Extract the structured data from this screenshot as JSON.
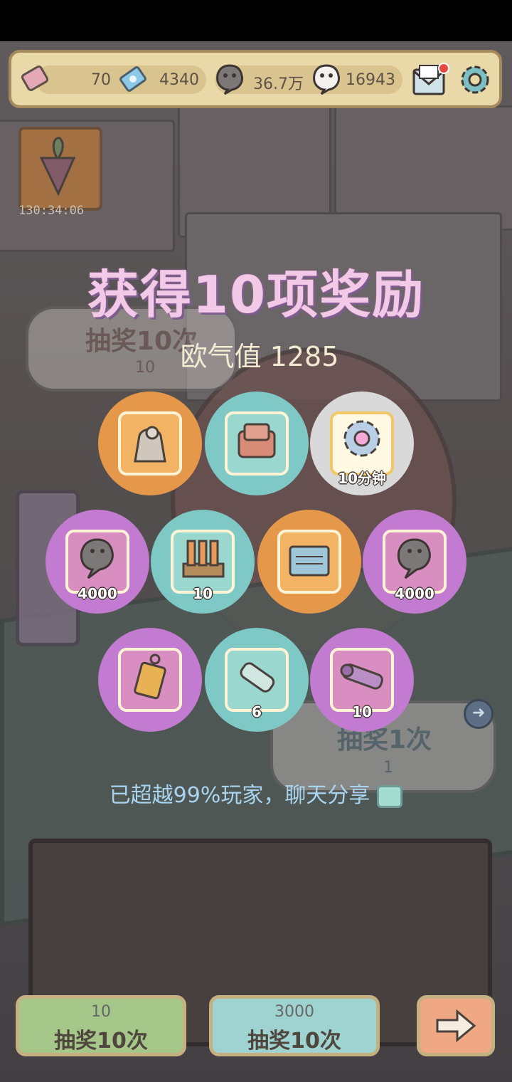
{
  "topbar": {
    "tickets": "70",
    "crystals": "4340",
    "ghost_dark": "36.7万",
    "ghost_white": "16943"
  },
  "timer": "130:34:06",
  "result": {
    "title": "获得10项奖励",
    "luck_label": "欧气值 1285"
  },
  "rewards": [
    {
      "icon": "pieta-statue-icon",
      "color": "orange",
      "qty": ""
    },
    {
      "icon": "throne-chair-icon",
      "color": "teal",
      "qty": ""
    },
    {
      "icon": "gear-boost-icon",
      "color": "white",
      "qty": "10分钟"
    },
    {
      "icon": "dark-ghost-currency-icon",
      "color": "purple",
      "qty": "4000"
    },
    {
      "icon": "tube-machine-icon",
      "color": "teal",
      "qty": "10"
    },
    {
      "icon": "stone-tablet-icon",
      "color": "orange",
      "qty": ""
    },
    {
      "icon": "dark-ghost-currency-icon",
      "color": "purple",
      "qty": "4000"
    },
    {
      "icon": "amulet-icon",
      "color": "purple",
      "qty": ""
    },
    {
      "icon": "scroll-icon",
      "color": "teal",
      "qty": "6"
    },
    {
      "icon": "cannon-icon",
      "color": "purple",
      "qty": "10"
    }
  ],
  "share_text": "已超越99%玩家，聊天分享",
  "bg_left": {
    "label": "抽奖10次",
    "cost": "10"
  },
  "bg_right": {
    "label": "抽奖1次",
    "cost": "1"
  },
  "buttons": {
    "left": {
      "cost": "10",
      "label": "抽奖10次",
      "color": "#a5c88a"
    },
    "mid": {
      "cost": "3000",
      "label": "抽奖10次",
      "color": "#9fd3d1"
    },
    "next": {
      "color": "#f0a884"
    }
  }
}
